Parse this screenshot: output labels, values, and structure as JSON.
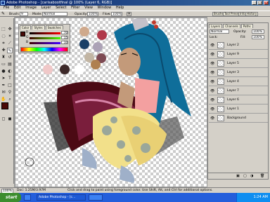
{
  "window": {
    "title": "Adobe Photoshop - [carisabootfinal @ 100% (Layer 6, RGB)]",
    "min_label": "_",
    "max_label": "□",
    "close_label": "×"
  },
  "menu": [
    "File",
    "Edit",
    "Image",
    "Layer",
    "Select",
    "Filter",
    "View",
    "Window",
    "Help"
  ],
  "options": {
    "brush_label": "Brush:",
    "brush_size": "9",
    "mode_label": "Mode:",
    "mode_value": "Normal",
    "opacity_label": "Opacity:",
    "opacity_value": "100%",
    "flow_label": "Flow:",
    "flow_value": "100%"
  },
  "palette_tabs": [
    "Brushes",
    "Tool Presets",
    "Info",
    "History"
  ],
  "color_panel": {
    "tabs": [
      "Color",
      "Styles",
      "Swatches"
    ],
    "channels": [
      {
        "label": "R",
        "value": "70"
      },
      {
        "label": "G",
        "value": "15"
      },
      {
        "label": "B",
        "value": "10"
      }
    ],
    "fg_color": "#4a0a08",
    "bg_color": "#ffffff"
  },
  "swatches": [
    "#cfa98c",
    "#b03848",
    "#1a3f66",
    "#aca2b6",
    "#c2b5a3",
    "#7d4a53",
    "#ffffff",
    "#af8050",
    "#f0c8c8",
    "#3c2828"
  ],
  "layers_panel": {
    "tabs": [
      "Layers",
      "Channels",
      "Paths"
    ],
    "blend_mode": "Normal",
    "opacity_label": "Opacity:",
    "opacity_value": "100%",
    "fill_label": "Fill:",
    "fill_value": "100%",
    "lock_label": "Lock:",
    "layers": [
      {
        "name": "Layer 2",
        "selected": false
      },
      {
        "name": "Layer 9",
        "selected": false
      },
      {
        "name": "Layer 5",
        "selected": false
      },
      {
        "name": "Layer 3",
        "selected": false
      },
      {
        "name": "Layer 4",
        "selected": false
      },
      {
        "name": "Layer 7",
        "selected": false
      },
      {
        "name": "Layer 6",
        "selected": false
      },
      {
        "name": "Layer 1",
        "selected": false
      },
      {
        "name": "Background",
        "selected": false
      }
    ]
  },
  "status": {
    "zoom": "100%",
    "doc": "Doc: 1.25M/3.97M",
    "hint": "Click and drag to paint using foreground color. Use Shift, Alt, and Ctrl for additional options."
  },
  "taskbar": {
    "start_label": "start",
    "items": [
      "",
      "Adobe Photoshop - [c...",
      ""
    ],
    "clock": "1:24 AM"
  }
}
